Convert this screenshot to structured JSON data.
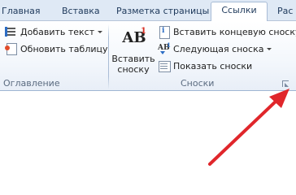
{
  "tabs": [
    {
      "label": "Главная"
    },
    {
      "label": "Вставка"
    },
    {
      "label": "Разметка страницы"
    },
    {
      "label": "Ссылки"
    },
    {
      "label": "Рас"
    }
  ],
  "toc_group": {
    "add_text_label": "Добавить текст",
    "update_table_label": "Обновить таблицу",
    "group_label": "Оглавление"
  },
  "footnotes_group": {
    "insert_footnote_label": "Вставить сноску",
    "insert_footnote_icon_text": "AB",
    "insert_footnote_icon_sup": "1",
    "insert_endnote_label": "Вставить концевую сноску",
    "next_footnote_label": "Следующая сноска",
    "next_footnote_icon_text": "AB",
    "next_footnote_icon_sup": "1",
    "show_notes_label": "Показать сноски",
    "group_label": "Сноски"
  },
  "colors": {
    "annotation_arrow": "#e0262b"
  }
}
